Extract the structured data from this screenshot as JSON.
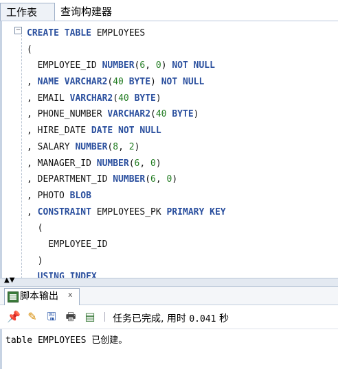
{
  "tabs": [
    {
      "label": "工作表"
    },
    {
      "label": "查询构建器"
    }
  ],
  "editor": {
    "lines": [
      [
        {
          "t": "CREATE TABLE",
          "k": "kw"
        },
        {
          "t": " EMPLOYEES",
          "k": ""
        }
      ],
      [
        {
          "t": "(",
          "k": ""
        }
      ],
      [
        {
          "t": "  EMPLOYEE_ID ",
          "k": ""
        },
        {
          "t": "NUMBER",
          "k": "kw"
        },
        {
          "t": "(",
          "k": ""
        },
        {
          "t": "6",
          "k": "num"
        },
        {
          "t": ", ",
          "k": ""
        },
        {
          "t": "0",
          "k": "num"
        },
        {
          "t": ") ",
          "k": ""
        },
        {
          "t": "NOT NULL",
          "k": "kw"
        }
      ],
      [
        {
          "t": ", ",
          "k": ""
        },
        {
          "t": "NAME VARCHAR2",
          "k": "kw"
        },
        {
          "t": "(",
          "k": ""
        },
        {
          "t": "40",
          "k": "num"
        },
        {
          "t": " ",
          "k": ""
        },
        {
          "t": "BYTE",
          "k": "kw"
        },
        {
          "t": ") ",
          "k": ""
        },
        {
          "t": "NOT NULL",
          "k": "kw"
        }
      ],
      [
        {
          "t": ", EMAIL ",
          "k": ""
        },
        {
          "t": "VARCHAR2",
          "k": "kw"
        },
        {
          "t": "(",
          "k": ""
        },
        {
          "t": "40",
          "k": "num"
        },
        {
          "t": " ",
          "k": ""
        },
        {
          "t": "BYTE",
          "k": "kw"
        },
        {
          "t": ")",
          "k": ""
        }
      ],
      [
        {
          "t": ", PHONE_NUMBER ",
          "k": ""
        },
        {
          "t": "VARCHAR2",
          "k": "kw"
        },
        {
          "t": "(",
          "k": ""
        },
        {
          "t": "40",
          "k": "num"
        },
        {
          "t": " ",
          "k": ""
        },
        {
          "t": "BYTE",
          "k": "kw"
        },
        {
          "t": ")",
          "k": ""
        }
      ],
      [
        {
          "t": ", HIRE_DATE ",
          "k": ""
        },
        {
          "t": "DATE NOT NULL",
          "k": "kw"
        }
      ],
      [
        {
          "t": ", SALARY ",
          "k": ""
        },
        {
          "t": "NUMBER",
          "k": "kw"
        },
        {
          "t": "(",
          "k": ""
        },
        {
          "t": "8",
          "k": "num"
        },
        {
          "t": ", ",
          "k": ""
        },
        {
          "t": "2",
          "k": "num"
        },
        {
          "t": ")",
          "k": ""
        }
      ],
      [
        {
          "t": ", MANAGER_ID ",
          "k": ""
        },
        {
          "t": "NUMBER",
          "k": "kw"
        },
        {
          "t": "(",
          "k": ""
        },
        {
          "t": "6",
          "k": "num"
        },
        {
          "t": ", ",
          "k": ""
        },
        {
          "t": "0",
          "k": "num"
        },
        {
          "t": ")",
          "k": ""
        }
      ],
      [
        {
          "t": ", DEPARTMENT_ID ",
          "k": ""
        },
        {
          "t": "NUMBER",
          "k": "kw"
        },
        {
          "t": "(",
          "k": ""
        },
        {
          "t": "6",
          "k": "num"
        },
        {
          "t": ", ",
          "k": ""
        },
        {
          "t": "0",
          "k": "num"
        },
        {
          "t": ")",
          "k": ""
        }
      ],
      [
        {
          "t": ", PHOTO ",
          "k": ""
        },
        {
          "t": "BLOB",
          "k": "kw"
        }
      ],
      [
        {
          "t": ", ",
          "k": ""
        },
        {
          "t": "CONSTRAINT",
          "k": "kw"
        },
        {
          "t": " EMPLOYEES_PK ",
          "k": ""
        },
        {
          "t": "PRIMARY KEY",
          "k": "kw"
        }
      ],
      [
        {
          "t": "  (",
          "k": ""
        }
      ],
      [
        {
          "t": "    EMPLOYEE_ID",
          "k": ""
        }
      ],
      [
        {
          "t": "  )",
          "k": ""
        }
      ],
      [
        {
          "t": "  ",
          "k": ""
        },
        {
          "t": "USING INDEX",
          "k": "kw"
        }
      ]
    ]
  },
  "output_panel": {
    "tab_label": "脚本输出",
    "close_glyph": "x",
    "status_prefix": "任务已完成, 用时",
    "status_time": "0.041",
    "status_unit": "秒",
    "output_text": "table EMPLOYEES 已创建。"
  },
  "toolbar_icons": [
    "pin-icon",
    "eraser-icon",
    "save-icon",
    "print-icon",
    "export-icon"
  ],
  "colors": {
    "keyword": "#2a4f9e",
    "number": "#1e7a1e"
  }
}
